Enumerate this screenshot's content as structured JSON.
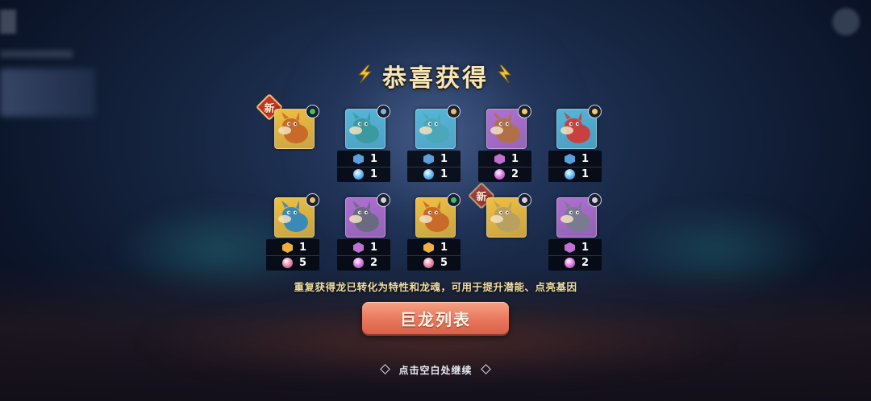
{
  "title": "恭喜获得",
  "hint": "重复获得龙已转化为特性和龙魂，可用于提升潜能、点亮基因",
  "button_label": "巨龙列表",
  "continue_text": "点击空白处继续",
  "new_label": "新",
  "dragons": [
    {
      "name": "dragon-1",
      "bg": "#f0c040",
      "body": "#c86a2a",
      "element_color": "#3fbf6a",
      "is_new": true,
      "traits": null,
      "souls": null
    },
    {
      "name": "dragon-2",
      "bg": "#56b7d8",
      "body": "#3a9aa0",
      "element_color": "#7fb0e8",
      "is_new": false,
      "traits": "1",
      "souls": "1",
      "trait_color": "#5aa0e0",
      "soul_color": "#6ec0ff"
    },
    {
      "name": "dragon-3",
      "bg": "#56b7d8",
      "body": "#4aa8b8",
      "element_color": "#e2c070",
      "is_new": false,
      "traits": "1",
      "souls": "1",
      "trait_color": "#5aa0e0",
      "soul_color": "#6ec0ff"
    },
    {
      "name": "dragon-4",
      "bg": "#b070d0",
      "body": "#b0704a",
      "element_color": "#f0d060",
      "is_new": false,
      "traits": "1",
      "souls": "2",
      "trait_color": "#c070d0",
      "soul_color": "#e080e8"
    },
    {
      "name": "dragon-5",
      "bg": "#56b7d8",
      "body": "#c84040",
      "element_color": "#f0d060",
      "is_new": false,
      "traits": "1",
      "souls": "1",
      "trait_color": "#5aa0e0",
      "soul_color": "#6ec0ff"
    },
    {
      "name": "dragon-6",
      "bg": "#f0c040",
      "body": "#3a8ab8",
      "element_color": "#e2c070",
      "is_new": false,
      "traits": "1",
      "souls": "5",
      "trait_color": "#f0b040",
      "soul_color": "#f090b0"
    },
    {
      "name": "dragon-7",
      "bg": "#b070d0",
      "body": "#6a6a80",
      "element_color": "#d0d0e0",
      "is_new": false,
      "traits": "1",
      "souls": "2",
      "trait_color": "#c070d0",
      "soul_color": "#e080e8"
    },
    {
      "name": "dragon-8",
      "bg": "#f0c040",
      "body": "#c86a2a",
      "element_color": "#3fbf6a",
      "is_new": false,
      "traits": "1",
      "souls": "5",
      "trait_color": "#f0b040",
      "soul_color": "#f090b0"
    },
    {
      "name": "dragon-9",
      "bg": "#f0c040",
      "body": "#b8a060",
      "element_color": "#d0d0e0",
      "is_new": true,
      "traits": null,
      "souls": null
    },
    {
      "name": "dragon-10",
      "bg": "#b070d0",
      "body": "#7a7a90",
      "element_color": "#d0d0e0",
      "is_new": false,
      "traits": "1",
      "souls": "2",
      "trait_color": "#c070d0",
      "soul_color": "#e080e8"
    }
  ]
}
